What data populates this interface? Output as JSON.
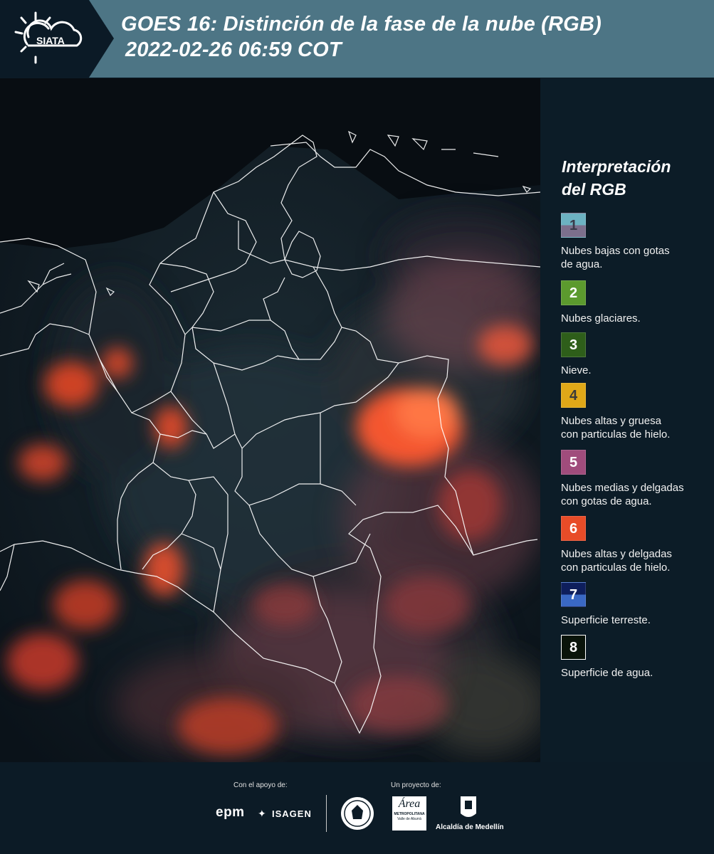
{
  "header": {
    "logo_text": "SIATA",
    "title_line1": "GOES 16: Distinción de la fase de la nube (RGB)",
    "title_line2": "2022-02-26 06:59 COT",
    "color": "#4d7585"
  },
  "legend": {
    "title_line1": "Interpretación",
    "title_line2": "del RGB",
    "items": [
      {
        "number": "1",
        "label_line1": "Nubes bajas con gotas",
        "label_line2": "de agua.",
        "color_top": "#6cb2c2",
        "color_bottom": "#7c6f8c",
        "number_color": "#3a3a4a"
      },
      {
        "number": "2",
        "label_line1": "Nubes glaciares.",
        "label_line2": "",
        "color_top": "#5c9a2e",
        "color_bottom": "#5c9a2e",
        "number_color": "#ffffff"
      },
      {
        "number": "3",
        "label_line1": "Nieve.",
        "label_line2": "",
        "color_top": "#2e5e1a",
        "color_bottom": "#2e5e1a",
        "number_color": "#ffffff"
      },
      {
        "number": "4",
        "label_line1": "Nubes altas y gruesa",
        "label_line2": "con particulas de hielo.",
        "color_top": "#e0a818",
        "color_bottom": "#e0a818",
        "number_color": "#3a3a3a"
      },
      {
        "number": "5",
        "label_line1": "Nubes medias y delgadas",
        "label_line2": "con gotas de agua.",
        "color_top": "#a04c7c",
        "color_bottom": "#a04c7c",
        "number_color": "#ffffff"
      },
      {
        "number": "6",
        "label_line1": "Nubes altas y delgadas",
        "label_line2": "con particulas de hielo.",
        "color_top": "#e84c28",
        "color_bottom": "#e84c28",
        "number_color": "#ffffff"
      },
      {
        "number": "7",
        "label_line1": "Superficie terreste.",
        "label_line2": "",
        "color_top": "#0e1e5c",
        "color_bottom": "#3a68c4",
        "number_color": "#ffffff"
      },
      {
        "number": "8",
        "label_line1": "Superficie de agua.",
        "label_line2": "",
        "color_top": "#0a140a",
        "color_bottom": "#0a140a",
        "number_color": "#ffffff"
      }
    ]
  },
  "footer": {
    "support_label": "Con el apoyo de:",
    "project_label": "Un proyecto de:",
    "epm": "epm",
    "isagen": "ISAGEN",
    "metro_script": "Área",
    "metro_line1": "METROPOLITANA",
    "metro_line2": "Valle de Aburrá",
    "alcaldia": "Alcaldía de Medellín"
  }
}
